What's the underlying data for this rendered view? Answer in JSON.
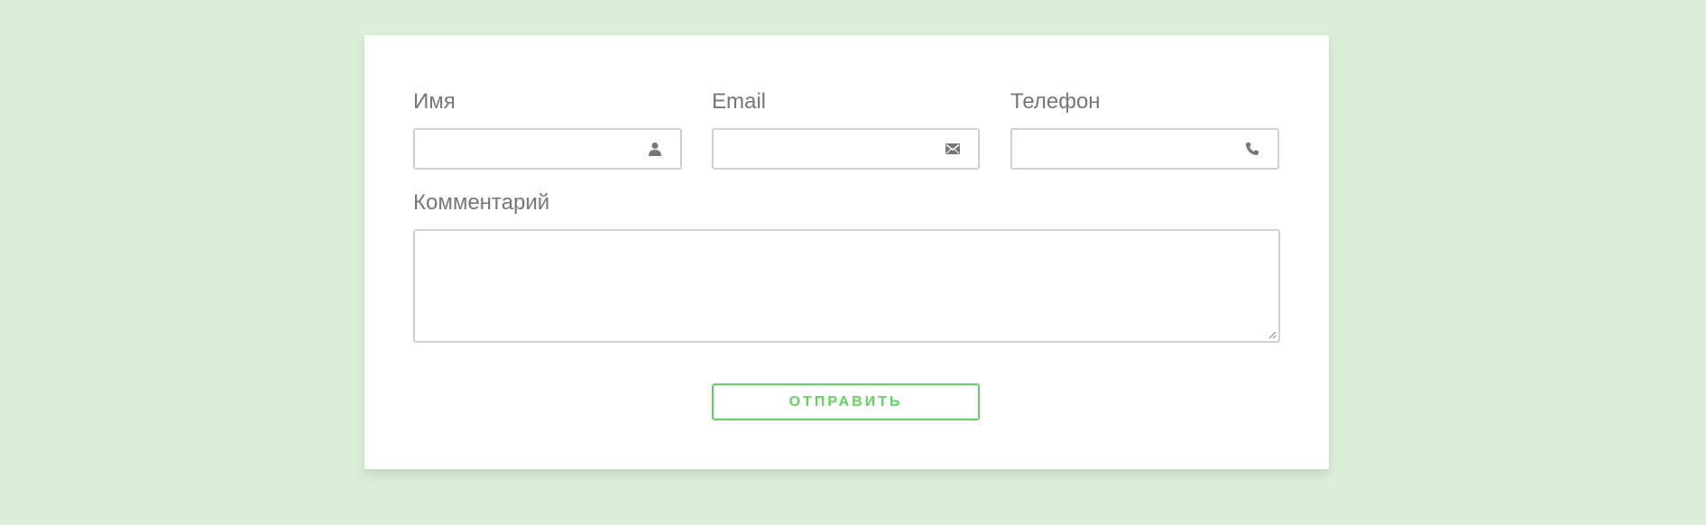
{
  "form": {
    "name": {
      "label": "Имя",
      "value": "",
      "icon": "user-icon"
    },
    "email": {
      "label": "Email",
      "value": "",
      "icon": "envelope-icon"
    },
    "phone": {
      "label": "Телефон",
      "value": "",
      "icon": "phone-icon"
    },
    "comment": {
      "label": "Комментарий",
      "value": ""
    },
    "submit_label": "ОТПРАВИТЬ"
  },
  "colors": {
    "background": "#d9efd6",
    "card": "#ffffff",
    "label": "#777777",
    "border": "#cfcfcf",
    "accent": "#5cd65c",
    "icon": "#777777"
  }
}
